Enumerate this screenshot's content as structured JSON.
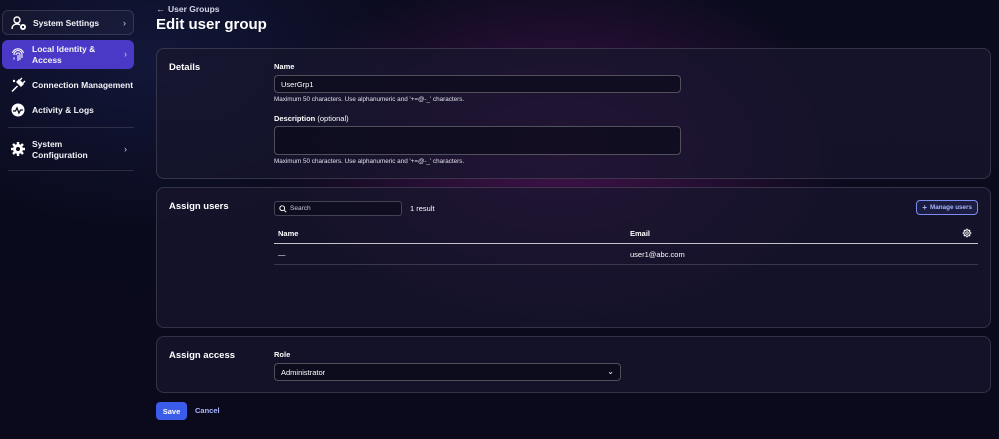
{
  "sidebar": {
    "items": [
      {
        "label": "System Settings",
        "icon": "user-gear-icon"
      },
      {
        "label": "Local Identity & Access",
        "icon": "fingerprint-icon"
      },
      {
        "label": "Connection Management",
        "icon": "plug-icon"
      },
      {
        "label": "Activity & Logs",
        "icon": "activity-icon"
      },
      {
        "label": "System Configuration",
        "icon": "gear-icon"
      }
    ]
  },
  "header": {
    "breadcrumb": "User Groups",
    "title": "Edit user group"
  },
  "details": {
    "title": "Details",
    "name_label": "Name",
    "name_value": "UserGrp1",
    "name_helper": "Maximum 50 characters. Use alphanumeric and '+=@-_' characters.",
    "description_label": "Description",
    "description_optional": "(optional)",
    "description_value": "",
    "description_helper": "Maximum 50 characters. Use alphanumeric and '+=@-_' characters."
  },
  "assign_users": {
    "title": "Assign users",
    "search_placeholder": "Search",
    "result_count": "1 result",
    "manage_button": "Manage users",
    "columns": [
      "Name",
      "Email"
    ],
    "rows": [
      {
        "name": "—",
        "email": "user1@abc.com"
      }
    ]
  },
  "assign_access": {
    "title": "Assign access",
    "role_label": "Role",
    "role_value": "Administrator"
  },
  "actions": {
    "save": "Save",
    "cancel": "Cancel"
  },
  "colors": {
    "accent": "#3b5bea",
    "nav_active": "#4a39c7",
    "link": "#a9b6ff"
  }
}
